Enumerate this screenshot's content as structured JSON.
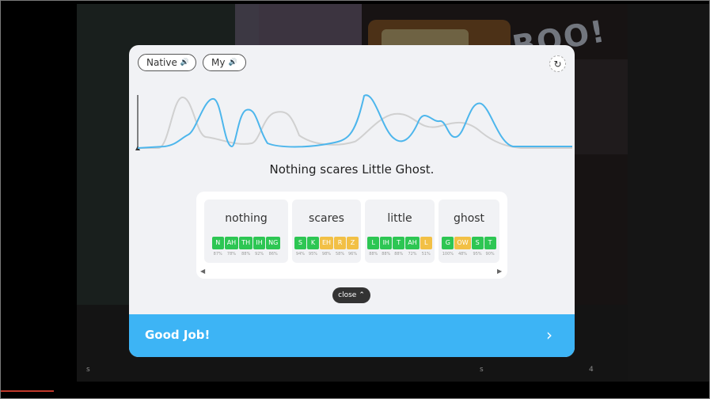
{
  "modal": {
    "native_label": "Native",
    "my_label": "My",
    "sentence": "Nothing scares Little Ghost.",
    "close_label": "close",
    "footer_text": "Good Job!"
  },
  "icons": {
    "speaker": "speaker-icon",
    "refresh": "refresh-icon",
    "chevron_up": "chevron-up-icon",
    "chevron_right": "chevron-right-icon"
  },
  "words": [
    {
      "word": "nothing",
      "phonemes": [
        {
          "p": "N",
          "score": "87%",
          "color": "green"
        },
        {
          "p": "AH",
          "score": "78%",
          "color": "green"
        },
        {
          "p": "TH",
          "score": "88%",
          "color": "green"
        },
        {
          "p": "IH",
          "score": "92%",
          "color": "green"
        },
        {
          "p": "NG",
          "score": "86%",
          "color": "green"
        }
      ]
    },
    {
      "word": "scares",
      "phonemes": [
        {
          "p": "S",
          "score": "94%",
          "color": "green"
        },
        {
          "p": "K",
          "score": "95%",
          "color": "green"
        },
        {
          "p": "EH",
          "score": "98%",
          "color": "amber"
        },
        {
          "p": "R",
          "score": "58%",
          "color": "amber"
        },
        {
          "p": "Z",
          "score": "96%",
          "color": "amber"
        }
      ]
    },
    {
      "word": "little",
      "phonemes": [
        {
          "p": "L",
          "score": "88%",
          "color": "green"
        },
        {
          "p": "IH",
          "score": "88%",
          "color": "green"
        },
        {
          "p": "T",
          "score": "88%",
          "color": "green"
        },
        {
          "p": "AH",
          "score": "72%",
          "color": "green"
        },
        {
          "p": "L",
          "score": "51%",
          "color": "amber"
        }
      ]
    },
    {
      "word": "ghost",
      "phonemes": [
        {
          "p": "G",
          "score": "100%",
          "color": "green"
        },
        {
          "p": "OW",
          "score": "48%",
          "color": "amber"
        },
        {
          "p": "S",
          "score": "95%",
          "color": "green"
        },
        {
          "p": "T",
          "score": "90%",
          "color": "green"
        }
      ]
    }
  ],
  "colors": {
    "good": "#2dc653",
    "fair": "#f2c045",
    "accent": "#3db4f5",
    "my_wave": "#4db6ec",
    "native_wave": "#d0d0d0"
  },
  "background": {
    "boo_text": "BOO!",
    "marks": [
      "s",
      "s",
      "4"
    ]
  }
}
